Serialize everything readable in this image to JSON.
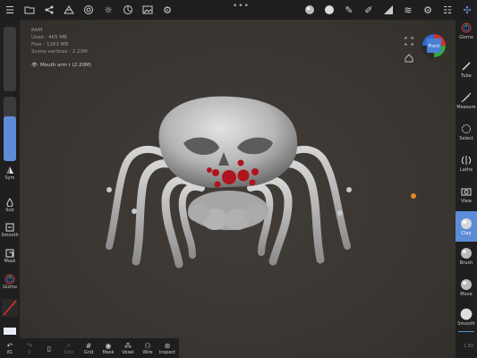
{
  "stats": {
    "ram_label": "RAM",
    "used": "Used : 465 MB",
    "free": "Free : 1263 MB",
    "vertices": "Scene vertices : 2.20M"
  },
  "mesh_label": "Mouth arm r (2.20M)",
  "gizmo_face": "Front",
  "left_panel": {
    "sym": "Sym",
    "sub": "Sub",
    "smooth": "Smooth",
    "mask": "Mask",
    "gizmo": "Gizmo"
  },
  "right_panel": {
    "gizmo": "Gizmo",
    "tube": "Tube",
    "measure": "Measure",
    "select": "Select",
    "lathe": "Lathe",
    "view": "View",
    "clay": "Clay",
    "brush": "Brush",
    "move": "Move",
    "smooth": "Smooth"
  },
  "bottom_bar": {
    "undo_count": "81",
    "redo_count": "0",
    "solo": "Solo",
    "grid": "Grid",
    "mask": "Mask",
    "voxel": "Voxel",
    "wire": "Wire",
    "inspect": "Inspect"
  },
  "version": "1.83",
  "colors": {
    "accent": "#5c8dd6",
    "panel": "#1f1f1f",
    "background": "#3a3632",
    "mesh": "#c4c4c4",
    "eyes": "#b0141c",
    "pivot": "#e08a2e"
  }
}
